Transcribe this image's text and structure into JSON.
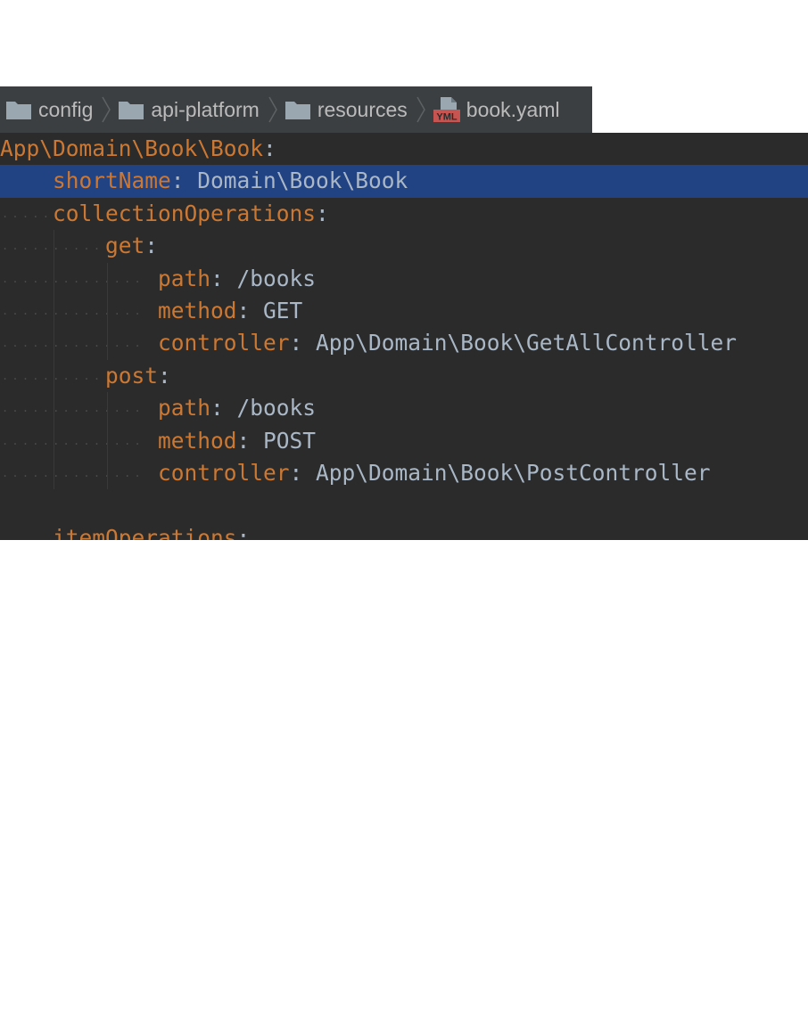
{
  "breadcrumb": {
    "items": [
      {
        "label": "config",
        "icon": "folder-icon"
      },
      {
        "label": "api-platform",
        "icon": "folder-icon"
      },
      {
        "label": "resources",
        "icon": "folder-icon"
      },
      {
        "label": "book.yaml",
        "icon": "yaml-file-icon"
      }
    ],
    "yml_badge": "YML"
  },
  "editor": {
    "lines": [
      {
        "key": "App\\Domain\\Book\\Book",
        "sep": ":",
        "value": ""
      },
      {
        "key": "shortName",
        "sep": ": ",
        "value": "Domain\\Book\\Book"
      },
      {
        "key": "collectionOperations",
        "sep": ":",
        "value": ""
      },
      {
        "key": "get",
        "sep": ":",
        "value": ""
      },
      {
        "key": "path",
        "sep": ": ",
        "value": "/books"
      },
      {
        "key": "method",
        "sep": ": ",
        "value": "GET"
      },
      {
        "key": "controller",
        "sep": ": ",
        "value": "App\\Domain\\Book\\GetAllController"
      },
      {
        "key": "post",
        "sep": ":",
        "value": ""
      },
      {
        "key": "path",
        "sep": ": ",
        "value": "/books"
      },
      {
        "key": "method",
        "sep": ": ",
        "value": "POST"
      },
      {
        "key": "controller",
        "sep": ": ",
        "value": "App\\Domain\\Book\\PostController"
      },
      {
        "key": "",
        "sep": "",
        "value": ""
      },
      {
        "key": "itemOperations",
        "sep": ":",
        "value": ""
      }
    ]
  },
  "colors": {
    "key": "#cc7832",
    "value": "#a9b7c6",
    "selection": "#214283",
    "editor_bg": "#2b2b2b",
    "breadcrumb_bg": "#3c3f41"
  }
}
